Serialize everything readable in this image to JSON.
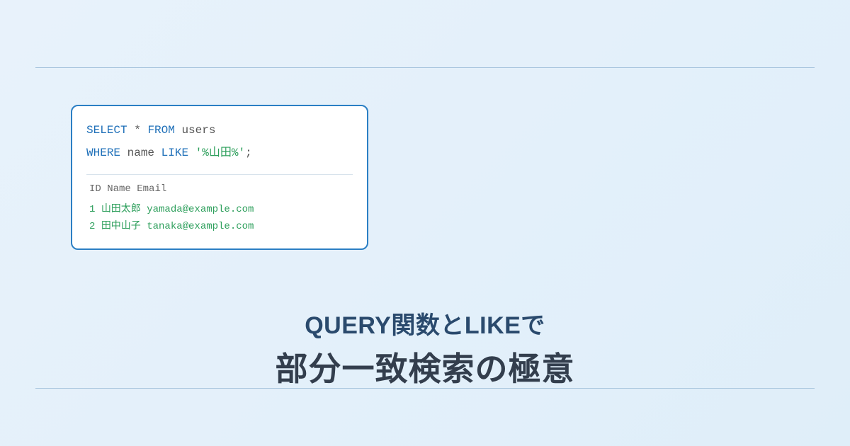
{
  "sql": {
    "keywords": {
      "select": "SELECT",
      "from": "FROM",
      "where": "WHERE",
      "like": "LIKE"
    },
    "star": "*",
    "table": "users",
    "column": "name",
    "pattern": "'%山田%'",
    "terminator": ";"
  },
  "result": {
    "header_id": "ID",
    "header_name": "Name",
    "header_email": "Email",
    "rows": [
      {
        "id": "1",
        "name": "山田太郎",
        "email": "yamada@example.com"
      },
      {
        "id": "2",
        "name": "田中山子",
        "email": "tanaka@example.com"
      }
    ]
  },
  "headline": {
    "line1": "QUERY関数とLIKEで",
    "line2": "部分一致検索の極意"
  }
}
